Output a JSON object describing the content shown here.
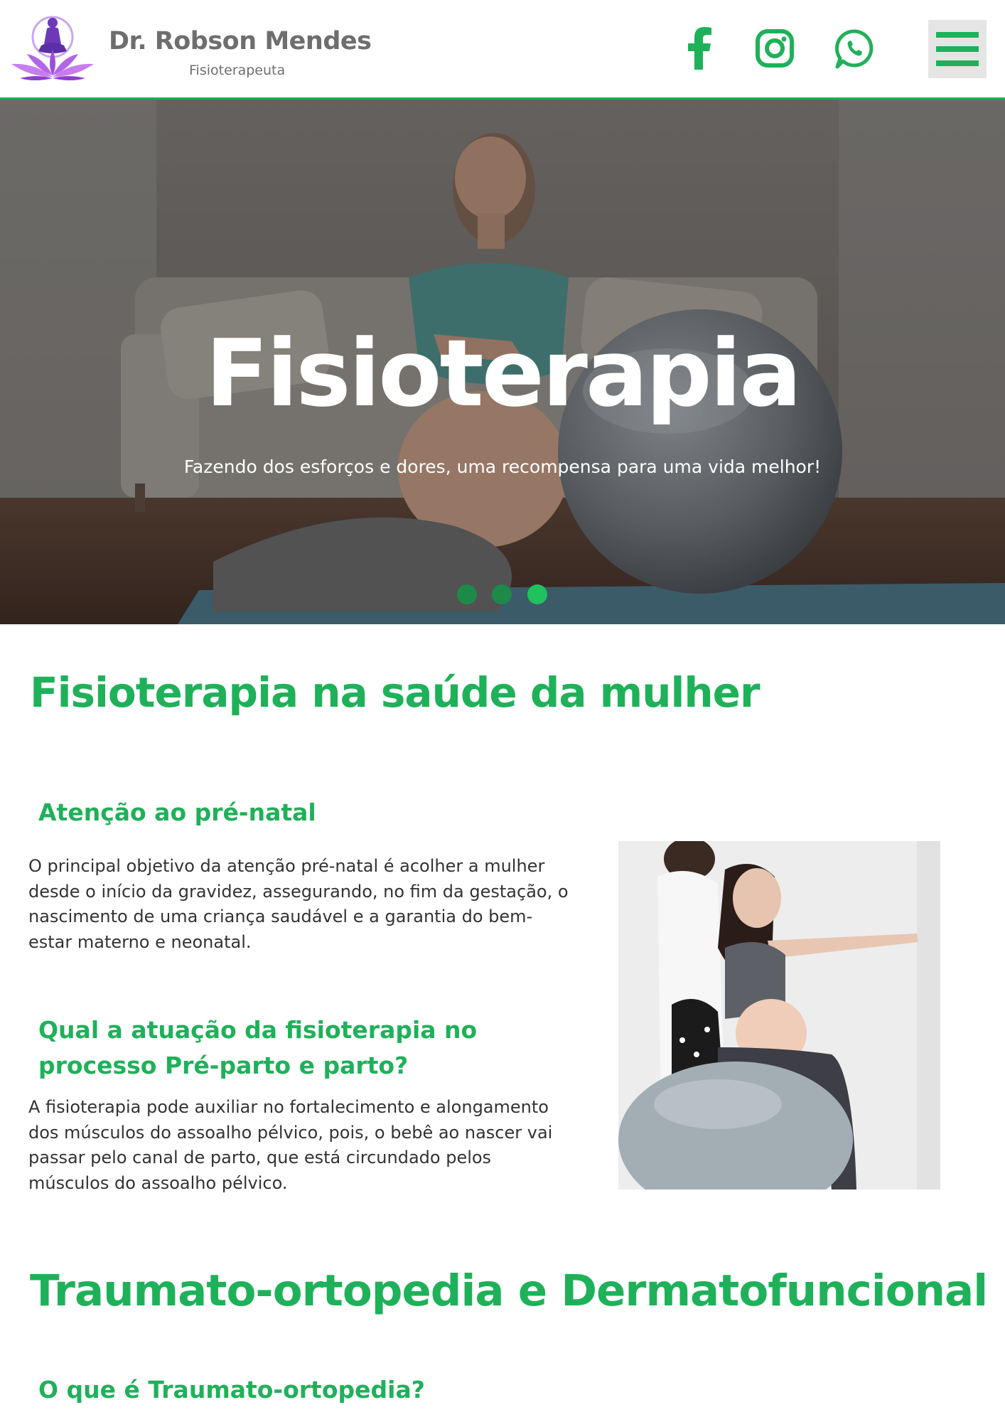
{
  "header": {
    "brand_name": "Dr. Robson Mendes",
    "brand_subtitle": "Fisioterapeuta",
    "social": [
      "facebook-icon",
      "instagram-icon",
      "whatsapp-icon"
    ],
    "menu_icon": "hamburger-menu-icon"
  },
  "hero": {
    "title": "Fisioterapia",
    "subtitle": "Fazendo dos esforços e dores, uma recompensa para uma vida melhor!",
    "slides_total": 3,
    "active_slide": 3
  },
  "sections": {
    "womens_health": {
      "title": "Fisioterapia na saúde da mulher",
      "prenatal_heading": "Atenção ao pré-natal",
      "prenatal_text": "O principal objetivo da atenção pré-natal é acolher a mulher desde o início da gravidez, assegurando, no fim da gestação, o nascimento de uma criança saudável e a garantia do bem-estar materno e neonatal.",
      "role_heading": "Qual a atuação da fisioterapia no processo Pré-parto e parto?",
      "role_text": "A fisioterapia pode auxiliar no fortalecimento e alongamento dos músculos do assoalho pélvico, pois, o bebê ao nascer vai passar pelo canal de parto, que está circundado pelos músculos do assoalho pélvico."
    },
    "orthopedics": {
      "title": "Traumato-ortopedia e Dermatofuncional",
      "question_heading": "O que é Traumato-ortopedia?"
    }
  },
  "colors": {
    "accent": "#1fb159",
    "brand_text": "#6e6e6e",
    "body_text": "#333333",
    "menu_bg": "#e5e5e5",
    "logo_purple": "#7b3fc9"
  }
}
